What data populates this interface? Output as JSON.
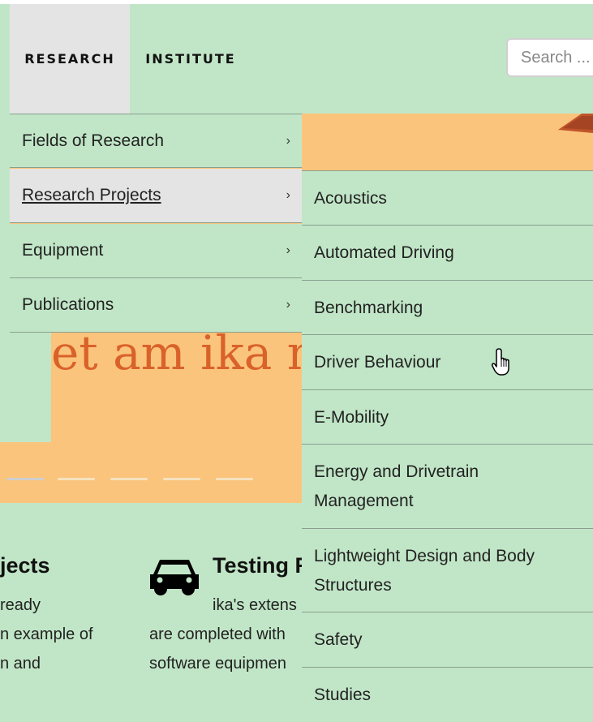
{
  "header": {
    "nav": [
      {
        "label": "RESEARCH"
      },
      {
        "label": "INSTITUTE"
      }
    ],
    "search_placeholder": "Search ..."
  },
  "hero": {
    "headline": "et am ika mi"
  },
  "content": {
    "left_heading": "jects",
    "left_lines": [
      "ready",
      "n example of",
      "n and"
    ],
    "right_heading": "Testing F",
    "right_lines": [
      "ika's extens",
      "are completed with",
      "software equipmen"
    ]
  },
  "menu_level1": {
    "items": [
      {
        "label": "Fields of Research"
      },
      {
        "label": "Research Projects"
      },
      {
        "label": "Equipment"
      },
      {
        "label": "Publications"
      }
    ],
    "chevron": "›"
  },
  "menu_level2": {
    "items": [
      {
        "label": "Acoustics"
      },
      {
        "label": "Automated Driving"
      },
      {
        "label": "Benchmarking"
      },
      {
        "label": "Driver Behaviour"
      },
      {
        "label": "E-Mobility"
      },
      {
        "label": "Energy and Drivetrain Management"
      },
      {
        "label": "Lightweight Design and Body Structures"
      },
      {
        "label": "Safety"
      },
      {
        "label": "Studies"
      }
    ]
  },
  "colors": {
    "background": "#c1e6c7",
    "hero": "#fbc47c",
    "hero_text": "#d9622a",
    "active_item": "#e4e4e4"
  }
}
